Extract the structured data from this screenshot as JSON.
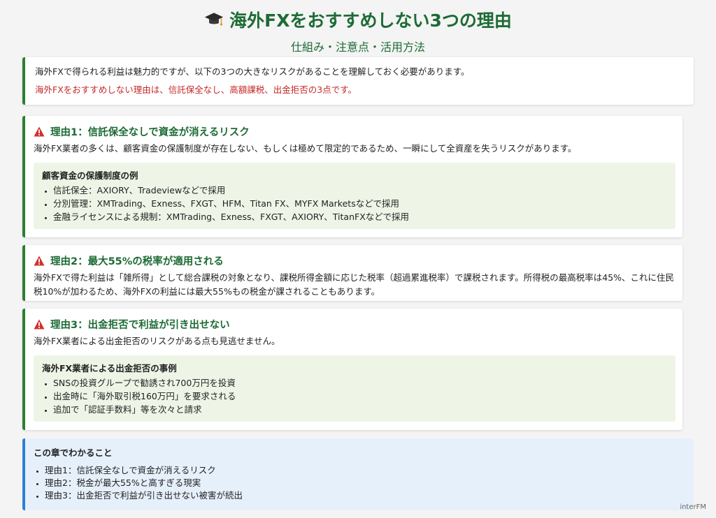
{
  "header": {
    "icon": "graduation-cap-icon",
    "title": "海外FXをおすすめしない3つの理由",
    "subtitle": "仕組み・注意点・活用方法"
  },
  "intro": {
    "text": "海外FXで得られる利益は魅力的ですが、以下の3つの大きなリスクがあることを理解しておく必要があります。",
    "highlight": "海外FXをおすすめしない理由は、信託保全なし、高額課税、出金拒否の3点です。"
  },
  "reasons": [
    {
      "icon": "warning-icon",
      "title": "理由1：信託保全なしで資金が消えるリスク",
      "text": "海外FX業者の多くは、顧客資金の保護制度が存在しない、もしくは極めて限定的であるため、一瞬にして全資産を失うリスクがあります。",
      "box_title": "顧客資金の保護制度の例",
      "items": [
        "信託保全：AXIORY、Tradeviewなどで採用",
        "分別管理：XMTrading、Exness、FXGT、HFM、Titan FX、MYFX Marketsなどで採用",
        "金融ライセンスによる規制：XMTrading、Exness、FXGT、AXIORY、TitanFXなどで採用"
      ]
    },
    {
      "icon": "warning-icon",
      "title": "理由2：最大55%の税率が適用される",
      "text": "海外FXで得た利益は「雑所得」として総合課税の対象となり、課税所得金額に応じた税率（超過累進税率）で課税されます。所得税の最高税率は45%、これに住民税10%が加わるため、海外FXの利益には最大55%もの税金が課されることもあります。"
    },
    {
      "icon": "warning-icon",
      "title": "理由3：出金拒否で利益が引き出せない",
      "text": "海外FX業者による出金拒否のリスクがある点も見逃せません。",
      "box_title": "海外FX業者による出金拒否の事例",
      "items": [
        "SNSの投資グループで勧誘され700万円を投資",
        "出金時に「海外取引税160万円」を要求される",
        "追加で「認証手数料」等を次々と請求"
      ]
    }
  ],
  "summary": {
    "title": "この章でわかること",
    "items": [
      "理由1：信託保全なしで資金が消えるリスク",
      "理由2：税金が最大55%と高すぎる現実",
      "理由3：出金拒否で利益が引き出せない被害が続出"
    ]
  },
  "brand": "interFM",
  "colors": {
    "accent_green": "#1d6b35",
    "warning_red": "#c62828",
    "summary_blue": "#2f7fd3",
    "subbox_bg": "#eef5e6"
  }
}
